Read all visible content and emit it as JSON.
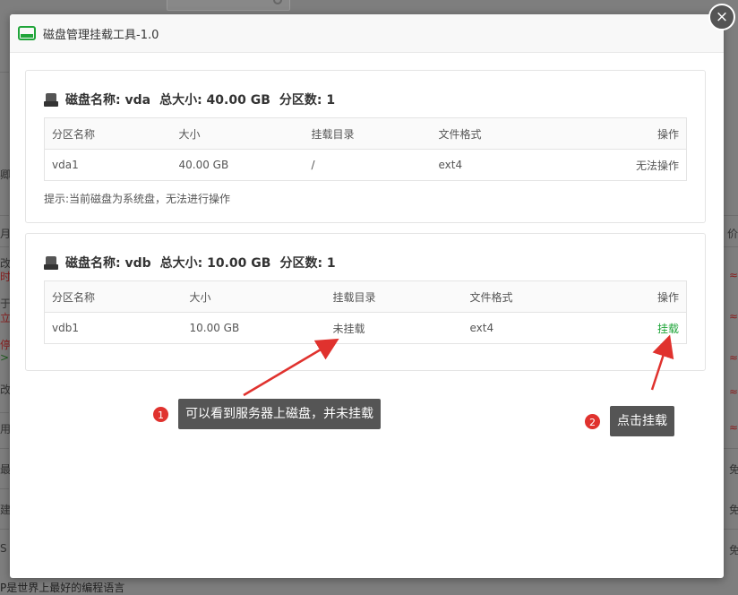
{
  "background": {
    "left_chars": [
      "卿",
      "月",
      "改",
      "时",
      "于",
      "立",
      "停",
      ">",
      "改",
      "用",
      "最",
      "建",
      "S"
    ],
    "right_chars": [
      "价",
      "≈",
      "≈",
      "≈",
      "≈",
      "≈",
      "免",
      "免",
      "免"
    ],
    "bottom_text": "P是世界上最好的编程语言"
  },
  "dialog": {
    "title": "磁盘管理挂载工具-1.0",
    "close_label": "×"
  },
  "disks": [
    {
      "name_label": "磁盘名称: vda",
      "size_label": "总大小: 40.00 GB",
      "parts_label": "分区数: 1",
      "headers": [
        "分区名称",
        "大小",
        "挂载目录",
        "文件格式",
        "操作"
      ],
      "rows": [
        {
          "name": "vda1",
          "size": "40.00 GB",
          "mount": "/",
          "fs": "ext4",
          "action": "无法操作"
        }
      ],
      "hint": "提示:当前磁盘为系统盘，无法进行操作"
    },
    {
      "name_label": "磁盘名称: vdb",
      "size_label": "总大小: 10.00 GB",
      "parts_label": "分区数: 1",
      "headers": [
        "分区名称",
        "大小",
        "挂载目录",
        "文件格式",
        "操作"
      ],
      "rows": [
        {
          "name": "vdb1",
          "size": "10.00 GB",
          "mount": "未挂载",
          "fs": "ext4",
          "action": "挂载"
        }
      ]
    }
  ],
  "annotations": [
    {
      "number": "1",
      "text": "可以看到服务器上磁盘，并未挂载"
    },
    {
      "number": "2",
      "text": "点击挂载"
    }
  ],
  "colors": {
    "accent_green": "#20a53a",
    "unmounted_orange": "#f0ad4e",
    "callout_bg": "#555555",
    "badge_red": "#e0322e",
    "arrow_red": "#e0322e"
  }
}
